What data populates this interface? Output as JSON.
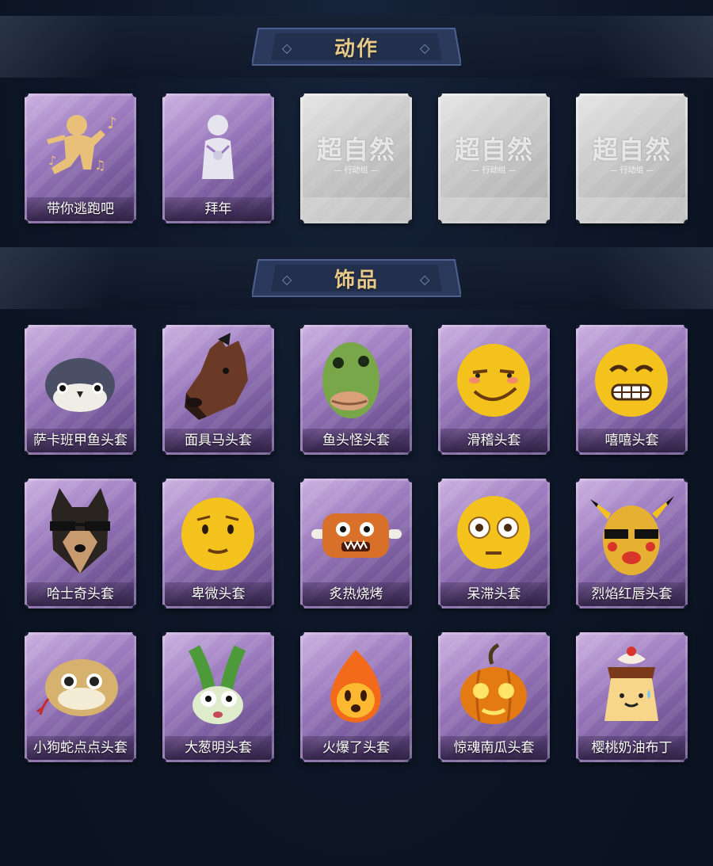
{
  "sections": [
    {
      "title": "动作"
    },
    {
      "title": "饰品"
    }
  ],
  "actions": [
    {
      "label": "带你逃跑吧",
      "icon": "dance-emote-icon"
    },
    {
      "label": "拜年",
      "icon": "bow-emote-icon"
    },
    {
      "label": "",
      "icon": "locked-placeholder",
      "stamp": "超自然",
      "stamp_sub": "— 行动组 —"
    },
    {
      "label": "",
      "icon": "locked-placeholder",
      "stamp": "超自然",
      "stamp_sub": "— 行动组 —"
    },
    {
      "label": "",
      "icon": "locked-placeholder",
      "stamp": "超自然",
      "stamp_sub": "— 行动组 —"
    }
  ],
  "accessories": [
    {
      "label": "萨卡班甲鱼头套",
      "icon": "fish-head-icon"
    },
    {
      "label": "面具马头套",
      "icon": "horse-head-icon"
    },
    {
      "label": "鱼头怪头套",
      "icon": "fish-monster-head-icon"
    },
    {
      "label": "滑稽头套",
      "icon": "funny-face-head-icon"
    },
    {
      "label": "嘻嘻头套",
      "icon": "grin-face-head-icon"
    },
    {
      "label": "哈士奇头套",
      "icon": "husky-head-icon"
    },
    {
      "label": "卑微头套",
      "icon": "humble-face-head-icon"
    },
    {
      "label": "炙热烧烤",
      "icon": "bbq-meat-icon"
    },
    {
      "label": "呆滞头套",
      "icon": "dazed-face-head-icon"
    },
    {
      "label": "烈焰红唇头套",
      "icon": "red-lips-head-icon"
    },
    {
      "label": "小狗蛇点点头套",
      "icon": "snake-head-icon"
    },
    {
      "label": "大葱明头套",
      "icon": "scallion-head-icon"
    },
    {
      "label": "火爆了头套",
      "icon": "fire-head-icon"
    },
    {
      "label": "惊魂南瓜头套",
      "icon": "pumpkin-head-icon"
    },
    {
      "label": "樱桃奶油布丁",
      "icon": "pudding-head-icon"
    }
  ],
  "colors": {
    "title": "#e7c98a",
    "card": "#9a79bd",
    "locked": "#c8c8c8",
    "background": "#0d1626"
  }
}
